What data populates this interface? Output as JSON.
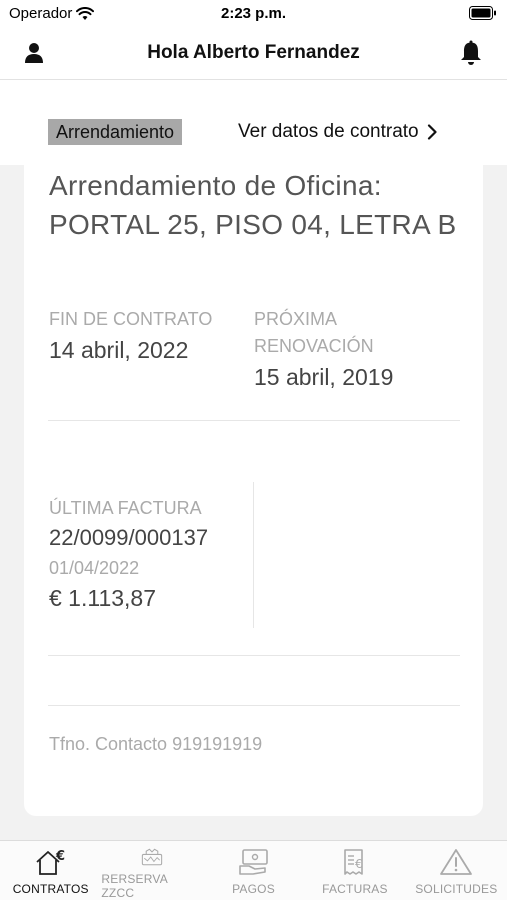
{
  "status": {
    "carrier": "Operador",
    "time": "2:23 p.m."
  },
  "nav": {
    "title": "Hola Alberto Fernandez"
  },
  "contract": {
    "type_badge": "Arrendamiento",
    "view_link": "Ver datos de contrato",
    "title": "Arrendamiento de Oficina: PORTAL 25, PISO 04, LETRA B",
    "end_label": "FIN DE CONTRATO",
    "end_value": "14 abril, 2022",
    "renewal_label_1": "PRÓXIMA",
    "renewal_label_2": "RENOVACIÓN",
    "renewal_value": "15 abril, 2019",
    "invoice_label": "ÚLTIMA FACTURA",
    "invoice_number": "22/0099/000137",
    "invoice_date": "01/04/2022",
    "invoice_amount": "€ 1.113,87",
    "phone": "Tfno. Contacto 919191919"
  },
  "tabs": [
    {
      "label": "CONTRATOS",
      "icon": "house-euro-icon",
      "active": true
    },
    {
      "label": "RERSERVA ZZCC",
      "icon": "shopping-bag-icon",
      "active": false
    },
    {
      "label": "PAGOS",
      "icon": "payment-hand-icon",
      "active": false
    },
    {
      "label": "FACTURAS",
      "icon": "invoice-euro-icon",
      "active": false
    },
    {
      "label": "SOLICITUDES",
      "icon": "warning-icon",
      "active": false
    }
  ],
  "colors": {
    "badge_bg": "#a8a8a8",
    "active_tab": "#111111",
    "inactive_tab": "#999999"
  }
}
